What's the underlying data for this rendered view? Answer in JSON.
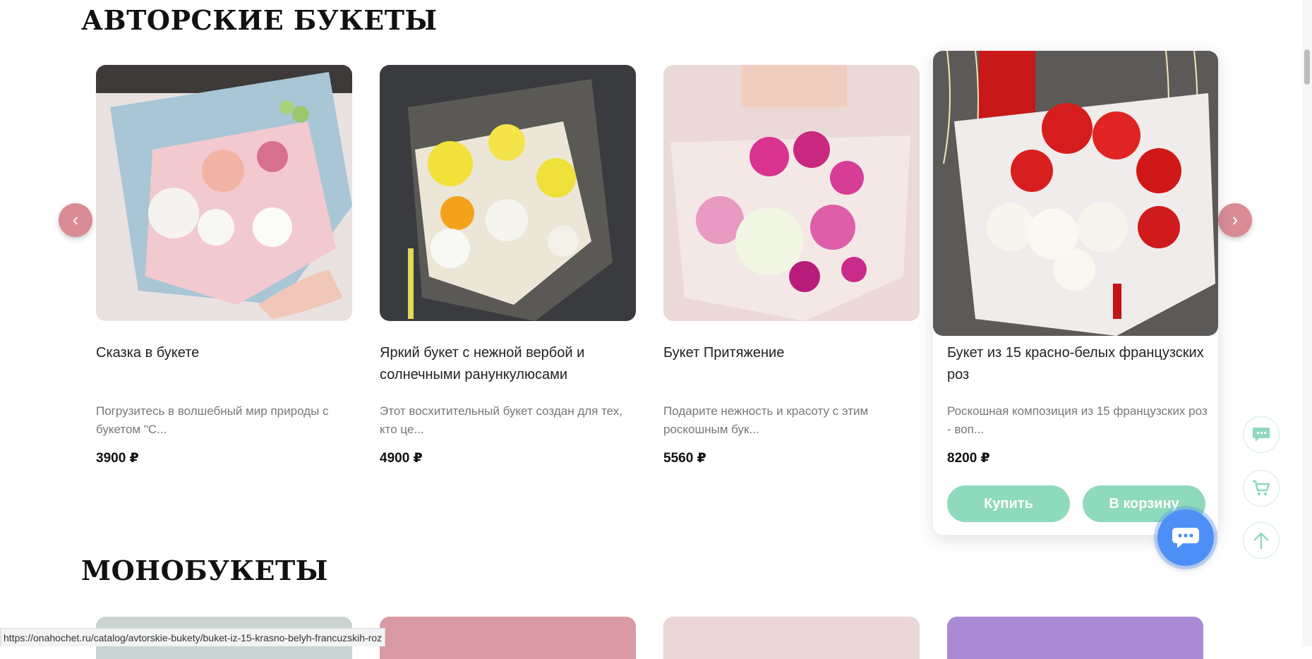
{
  "sections": {
    "author_title": "АВТОРСКИЕ БУКЕТЫ",
    "mono_title": "МОНОБУКЕТЫ"
  },
  "carousel": {
    "prev_icon": "‹",
    "next_icon": "›"
  },
  "products": [
    {
      "name": "Сказка в букете",
      "desc": "Погрузитесь в волшебный мир природы с букетом \"С...",
      "price": "3900 ₽"
    },
    {
      "name": "Яркий букет с нежной вербой и солнечными ранункулюсами",
      "desc": "Этот восхитительный букет создан для тех, кто це...",
      "price": "4900 ₽"
    },
    {
      "name": "Букет Притяжение",
      "desc": "Подарите нежность и красоту с этим роскошным бук...",
      "price": "5560 ₽"
    },
    {
      "name": "Букет из 15 красно-белых французских роз",
      "desc": "Роскошная композиция из 15 французских роз - воп...",
      "price": "8200 ₽",
      "buy_label": "Купить",
      "cart_label": "В корзину"
    }
  ],
  "status_bar": {
    "url": "https://onahochet.ru/catalog/avtorskie-bukety/buket-iz-15-krasno-belyh-francuzskih-roz"
  },
  "colors": {
    "accent_green": "#8fd9bd",
    "arrow_pink": "#d98c95",
    "chat_blue": "#4d8ff6"
  },
  "icons": {
    "side_chat": "chat-bubble-icon",
    "side_cart": "cart-icon",
    "side_up": "arrow-up-icon",
    "fab": "chat-icon"
  }
}
